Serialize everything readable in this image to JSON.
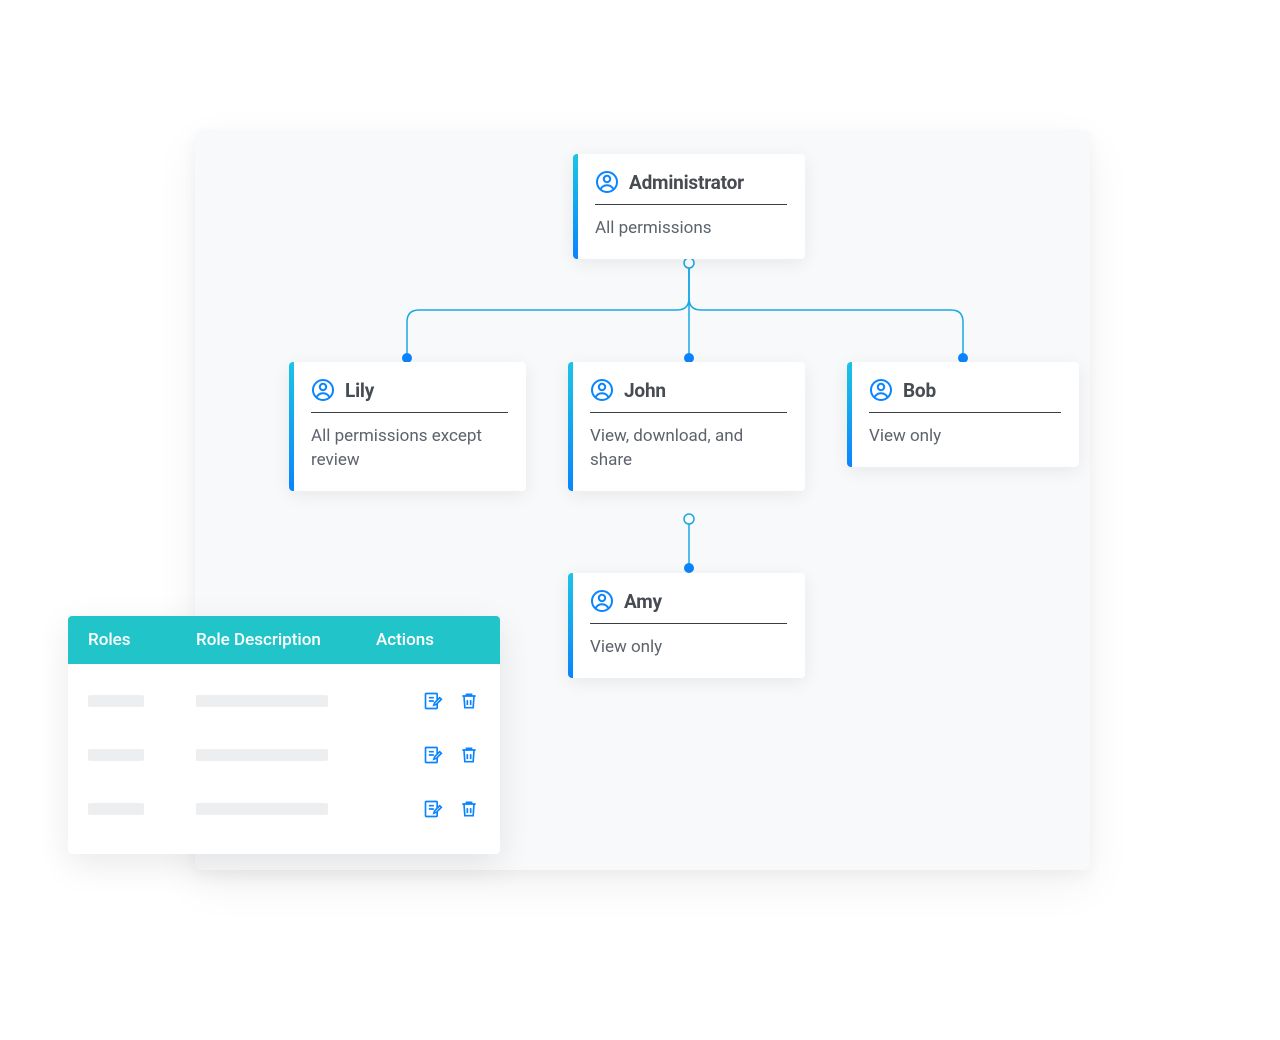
{
  "colors": {
    "accent_gradient_start": "#1cc4e4",
    "accent_gradient_end": "#0a84ff",
    "teal_header": "#21c4c9",
    "text_primary": "#474b52",
    "text_secondary": "#5d636b",
    "icon_blue": "#0a84ff"
  },
  "hierarchy": {
    "root": {
      "name": "Administrator",
      "permissions": "All permissions"
    },
    "children": [
      {
        "name": "Lily",
        "permissions": "All permissions except review"
      },
      {
        "name": "John",
        "permissions": "View, download, and share"
      },
      {
        "name": "Bob",
        "permissions": "View only"
      }
    ],
    "grandchild": {
      "name": "Amy",
      "permissions": "View only"
    }
  },
  "roles_table": {
    "headers": {
      "roles": "Roles",
      "description": "Role Description",
      "actions": "Actions"
    },
    "row_count": 3,
    "action_icons": [
      "edit",
      "delete"
    ]
  }
}
